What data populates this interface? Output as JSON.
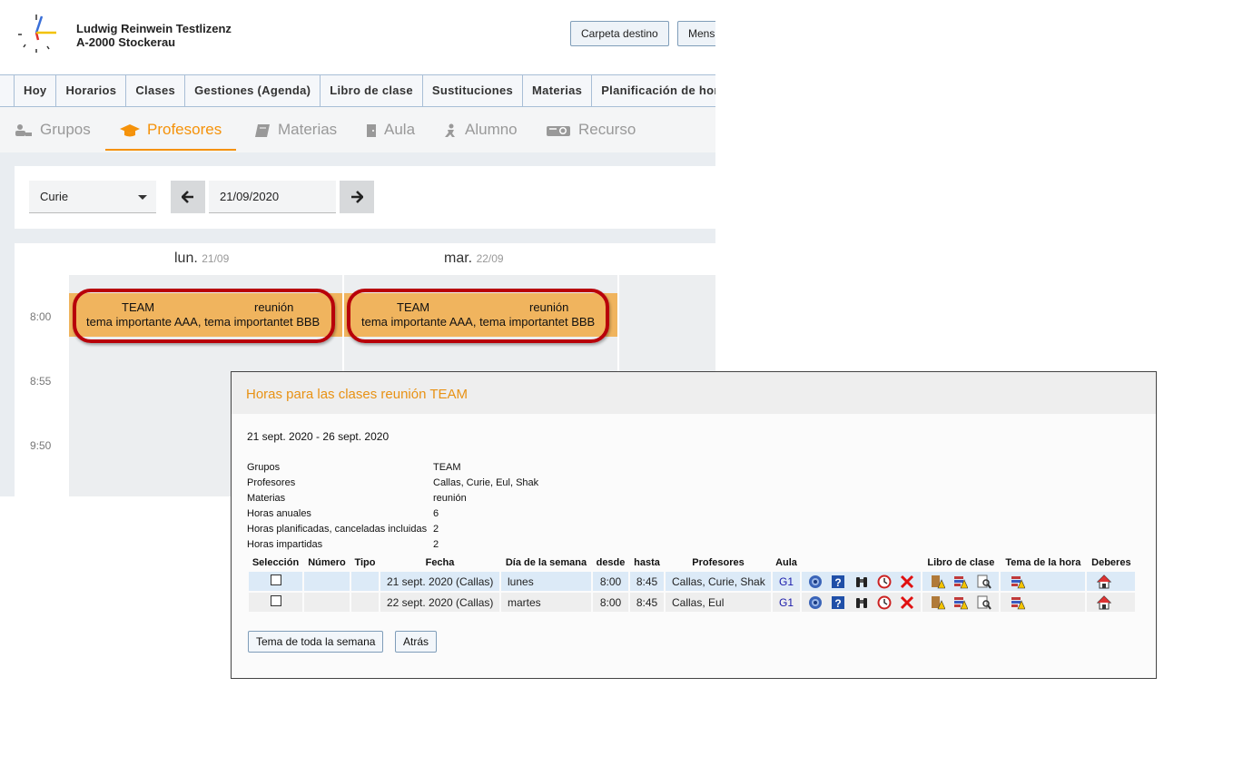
{
  "header": {
    "org_name": "Ludwig Reinwein Testlizenz",
    "org_address": "A-2000 Stockerau",
    "buttons": [
      "Carpeta destino",
      "Mens"
    ]
  },
  "menu": [
    "Hoy",
    "Horarios",
    "Clases",
    "Gestiones (Agenda)",
    "Libro de clase",
    "Sustituciones",
    "Materias",
    "Planificación de hor"
  ],
  "tabs": [
    {
      "label": "Grupos",
      "icon": "groups-icon",
      "active": false
    },
    {
      "label": "Profesores",
      "icon": "graduation-cap-icon",
      "active": true
    },
    {
      "label": "Materias",
      "icon": "book-icon",
      "active": false
    },
    {
      "label": "Aula",
      "icon": "door-icon",
      "active": false
    },
    {
      "label": "Alumno",
      "icon": "student-icon",
      "active": false
    },
    {
      "label": "Recurso",
      "icon": "projector-icon",
      "active": false
    }
  ],
  "filter": {
    "teacher": "Curie",
    "date": "21/09/2020"
  },
  "timetable": {
    "days": [
      {
        "name": "lun.",
        "date": "21/09"
      },
      {
        "name": "mar.",
        "date": "22/09"
      }
    ],
    "hours": [
      "8:00",
      "8:55",
      "9:50"
    ],
    "lessons": [
      {
        "group": "TEAM",
        "subject": "reunión",
        "topic": "tema importante AAA, tema importantet BBB"
      },
      {
        "group": "TEAM",
        "subject": "reunión",
        "topic": "tema importante AAA, tema importantet BBB"
      }
    ]
  },
  "dialog": {
    "title": "Horas para las clases reunión TEAM",
    "range": "21 sept. 2020 - 26 sept. 2020",
    "info": [
      {
        "label": "Grupos",
        "value": "TEAM"
      },
      {
        "label": "Profesores",
        "value": "Callas, Curie, Eul, Shak"
      },
      {
        "label": "Materias",
        "value": "reunión"
      },
      {
        "label": "Horas anuales",
        "value": "6"
      },
      {
        "label": "Horas planificadas, canceladas incluidas",
        "value": "2"
      },
      {
        "label": "Horas impartidas",
        "value": "2"
      }
    ],
    "columns": [
      "Selección",
      "Número",
      "Tipo",
      "Fecha",
      "Día de la semana",
      "desde",
      "hasta",
      "Profesores",
      "Aula",
      "",
      "Libro de clase",
      "Tema de la hora",
      "Deberes"
    ],
    "rows": [
      {
        "fecha": "21 sept. 2020 (Callas)",
        "dia": "lunes",
        "desde": "8:00",
        "hasta": "8:45",
        "profesores": "Callas, Curie, Shak",
        "aula": "G1"
      },
      {
        "fecha": "22 sept. 2020 (Callas)",
        "dia": "martes",
        "desde": "8:00",
        "hasta": "8:45",
        "profesores": "Callas, Eul",
        "aula": "G1"
      }
    ],
    "buttons": [
      "Tema de toda la semana",
      "Atrás"
    ]
  },
  "colors": {
    "accent": "#f5920a",
    "lesson_bg": "#f0b45e",
    "highlight_ring": "#b8000a"
  }
}
